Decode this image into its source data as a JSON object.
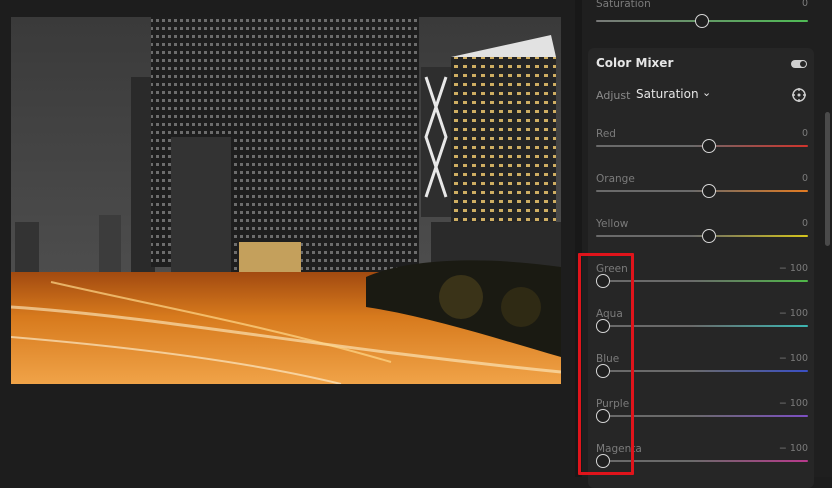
{
  "panel": {
    "top_slider": {
      "label": "Saturation",
      "value": "0",
      "fraction": 0.5,
      "track_from": "#787878",
      "track_to": "#4fbb55"
    },
    "color_mixer": {
      "title": "Color Mixer",
      "adjust_label": "Adjust",
      "adjust_value": "Saturation",
      "sliders": [
        {
          "label": "Red",
          "value": "0",
          "fraction": 0.5,
          "color": "#d0342c"
        },
        {
          "label": "Orange",
          "value": "0",
          "fraction": 0.5,
          "color": "#e27b22"
        },
        {
          "label": "Yellow",
          "value": "0",
          "fraction": 0.5,
          "color": "#d4c41c"
        },
        {
          "label": "Green",
          "value": "− 100",
          "fraction": 0.0,
          "color": "#4fb848"
        },
        {
          "label": "Aqua",
          "value": "− 100",
          "fraction": 0.0,
          "color": "#3cb6b2"
        },
        {
          "label": "Blue",
          "value": "− 100",
          "fraction": 0.0,
          "color": "#3a4fc4"
        },
        {
          "label": "Purple",
          "value": "− 100",
          "fraction": 0.0,
          "color": "#7c4fc2"
        },
        {
          "label": "Magenta",
          "value": "− 100",
          "fraction": 0.0,
          "color": "#b8398c"
        }
      ]
    }
  },
  "icons": {
    "toggle": "toggle-switch-icon",
    "chevron": "chevron-down-icon",
    "target": "targeted-adjustment-icon"
  },
  "colors": {
    "highlight": "#e0141b",
    "accent_text": "#e6e6e6"
  }
}
